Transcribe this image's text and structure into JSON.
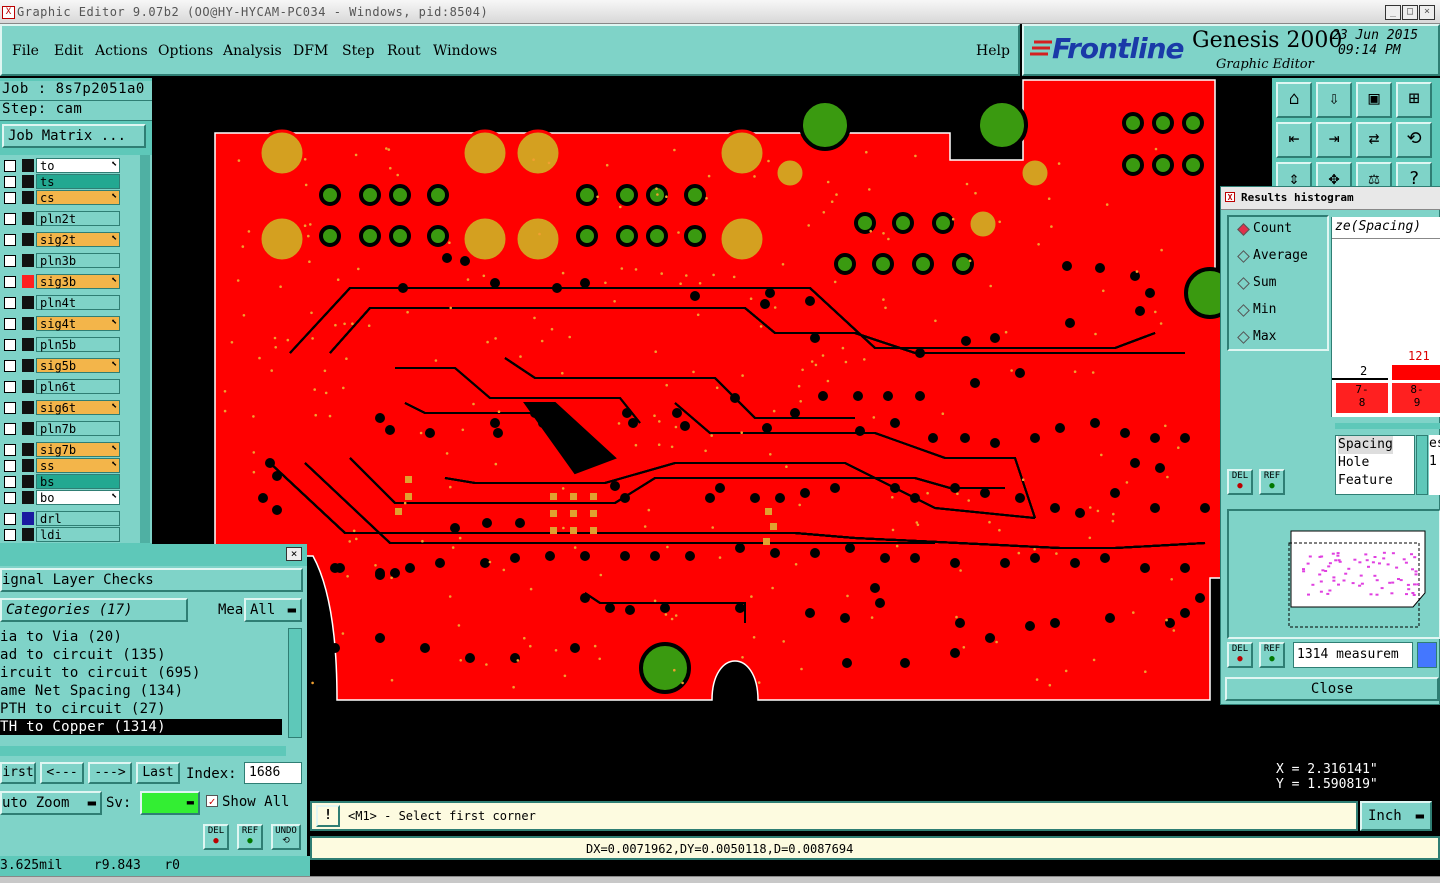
{
  "window": {
    "title": "Graphic Editor 9.07b2 (OO@HY-HYCAM-PC034 - Windows, pid:8504)"
  },
  "menu": {
    "items": [
      "File",
      "Edit",
      "Actions",
      "Options",
      "Analysis",
      "DFM",
      "Step",
      "Rout",
      "Windows"
    ],
    "help": "Help"
  },
  "brand": {
    "logo": "Frontline",
    "product": "Genesis 2000",
    "module": "Graphic Editor",
    "date": "23 Jun 2015",
    "time": "09:14 PM"
  },
  "job": {
    "job_line": "Job : 8s7p2051a0",
    "step_line": "Step: cam",
    "matrix_button": "Job Matrix ..."
  },
  "layers": [
    {
      "name": "to",
      "color": "#ffffff",
      "indicator": "#111111",
      "arrow": true
    },
    {
      "name": "ts",
      "color": "#23a891",
      "indicator": "#111111",
      "arrow": false
    },
    {
      "name": "cs",
      "color": "#f3b54a",
      "indicator": "#111111",
      "arrow": true
    },
    {
      "name": "pln2t",
      "color": "#7fd3c8",
      "indicator": "#111111",
      "arrow": false
    },
    {
      "name": "sig2t",
      "color": "#f3b54a",
      "indicator": "#111111",
      "arrow": true
    },
    {
      "name": "pln3b",
      "color": "#7fd3c8",
      "indicator": "#111111",
      "arrow": false
    },
    {
      "name": "sig3b",
      "color": "#f3b54a",
      "indicator": "#ff2020",
      "arrow": true
    },
    {
      "name": "pln4t",
      "color": "#7fd3c8",
      "indicator": "#111111",
      "arrow": false
    },
    {
      "name": "sig4t",
      "color": "#f3b54a",
      "indicator": "#111111",
      "arrow": true
    },
    {
      "name": "pln5b",
      "color": "#7fd3c8",
      "indicator": "#111111",
      "arrow": false
    },
    {
      "name": "sig5b",
      "color": "#f3b54a",
      "indicator": "#111111",
      "arrow": true
    },
    {
      "name": "pln6t",
      "color": "#7fd3c8",
      "indicator": "#111111",
      "arrow": false
    },
    {
      "name": "sig6t",
      "color": "#f3b54a",
      "indicator": "#111111",
      "arrow": true
    },
    {
      "name": "pln7b",
      "color": "#7fd3c8",
      "indicator": "#111111",
      "arrow": false
    },
    {
      "name": "sig7b",
      "color": "#f3b54a",
      "indicator": "#111111",
      "arrow": true
    },
    {
      "name": "ss",
      "color": "#f3b54a",
      "indicator": "#111111",
      "arrow": true
    },
    {
      "name": "bs",
      "color": "#23a891",
      "indicator": "#111111",
      "arrow": false
    },
    {
      "name": "bo",
      "color": "#ffffff",
      "indicator": "#111111",
      "arrow": true
    },
    {
      "name": "drl",
      "color": "#7fd3c8",
      "indicator": "#1a1aa0",
      "arrow": false
    },
    {
      "name": "ldi",
      "color": "#7fd3c8",
      "indicator": "#111111",
      "arrow": false
    }
  ],
  "histogram": {
    "title": "Results histogram",
    "radio": [
      "Count",
      "Average",
      "Sum",
      "Min",
      "Max"
    ],
    "selected": "Count",
    "header": "ze(Spacing)",
    "bar_labels": [
      "2",
      "121"
    ],
    "bin_labels": [
      "7-\n8",
      "8-\n9"
    ],
    "list": [
      "Spacing",
      "Hole",
      "Feature"
    ],
    "list_right": "es",
    "list_right2": "1",
    "del": "DEL",
    "ref": "REF",
    "measure_text": "1314 measurem",
    "close": "Close"
  },
  "checks": {
    "title": "ignal Layer Checks",
    "categories_label": "Categories (17)",
    "meas_label": "Meas:",
    "meas_value": "All",
    "items": [
      "ia to Via (20)",
      "ad to circuit (135)",
      "ircuit to circuit (695)",
      "ame Net Spacing (134)",
      "PTH to circuit (27)",
      "TH to Copper (1314)"
    ],
    "selected_index": 5,
    "nav": [
      "irst",
      "<---",
      "--->",
      "Last"
    ],
    "index_label": "Index:",
    "index_value": "1686",
    "zoom_value": "uto Zoom",
    "sv_label": "Sv:",
    "show_all": "Show All",
    "del": "DEL",
    "ref": "REF",
    "undo": "UNDO"
  },
  "status": {
    "message": "<M1> - Select first corner",
    "measure": "DX=0.0071962,DY=0.0050118,D=0.0087694",
    "bottom": "3.625mil    r9.843   r0",
    "x": "X = 2.316141\"",
    "y": "Y = 1.590819\"",
    "units": "Inch"
  },
  "colors": {
    "board": "#ff0000",
    "panel": "#7fd3c8",
    "pad_gold": "#d4a020",
    "via_green": "#3a9a10"
  }
}
